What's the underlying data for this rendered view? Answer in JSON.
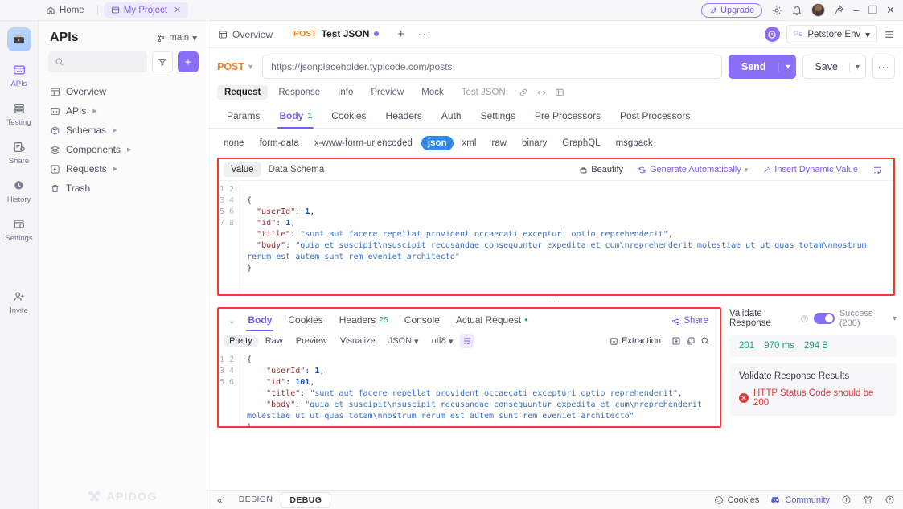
{
  "titlebar": {
    "home": "Home",
    "project": "My Project",
    "close_tab": "✕",
    "upgrade": "Upgrade",
    "icons": {
      "gear": "gear-icon",
      "bell": "bell-icon",
      "pin": "pin-icon"
    },
    "window": {
      "minimize": "–",
      "maximize": "❐",
      "close": "✕"
    }
  },
  "rail": {
    "items": [
      {
        "label": "APIs",
        "active": true
      },
      {
        "label": "Testing",
        "active": false
      },
      {
        "label": "Share",
        "active": false
      },
      {
        "label": "History",
        "active": false
      },
      {
        "label": "Settings",
        "active": false
      },
      {
        "label": "Invite",
        "active": false
      }
    ]
  },
  "sidebar": {
    "title": "APIs",
    "branch": "main",
    "search_placeholder": "",
    "filter_icon": "filter-icon",
    "add_label": "+",
    "tree": [
      {
        "label": "Overview",
        "expandable": false
      },
      {
        "label": "APIs",
        "expandable": true
      },
      {
        "label": "Schemas",
        "expandable": true
      },
      {
        "label": "Components",
        "expandable": true
      },
      {
        "label": "Requests",
        "expandable": true
      },
      {
        "label": "Trash",
        "expandable": false
      }
    ],
    "watermark": "APIDOG"
  },
  "doctabs": {
    "overview": "Overview",
    "active_tab": {
      "method": "POST",
      "name": "Test JSON"
    },
    "add": "+",
    "more": "···",
    "env": {
      "badge": "Pe",
      "name": "Petstore Env"
    }
  },
  "urlbar": {
    "method": "POST",
    "url": "https://jsonplaceholder.typicode.com/posts",
    "send": "Send",
    "save": "Save",
    "more": "···"
  },
  "request": {
    "top_tabs": [
      "Request",
      "Response",
      "Info",
      "Preview",
      "Mock"
    ],
    "top_active": "Request",
    "doc_name": "Test JSON",
    "tabs": [
      {
        "label": "Params",
        "badge": ""
      },
      {
        "label": "Body",
        "badge": "1"
      },
      {
        "label": "Cookies",
        "badge": ""
      },
      {
        "label": "Headers",
        "badge": ""
      },
      {
        "label": "Auth",
        "badge": ""
      },
      {
        "label": "Settings",
        "badge": ""
      },
      {
        "label": "Pre Processors",
        "badge": ""
      },
      {
        "label": "Post Processors",
        "badge": ""
      }
    ],
    "active_tab": "Body",
    "body_types": [
      "none",
      "form-data",
      "x-www-form-urlencoded",
      "json",
      "xml",
      "raw",
      "binary",
      "GraphQL",
      "msgpack"
    ],
    "selected_body_type": "json",
    "editor_tabs": [
      "Value",
      "Data Schema"
    ],
    "editor_active": "Value",
    "tools": {
      "beautify": "Beautify",
      "generate": "Generate Automatically",
      "insert_dynamic": "Insert Dynamic Value",
      "wrap_icon": "wrap-lines-icon"
    },
    "body_json": {
      "line_count": 8,
      "lines": [
        "",
        "{",
        "  \"userId\": 1,",
        "  \"id\": 1,",
        "  \"title\": \"sunt aut facere repellat provident occaecati excepturi optio reprehenderit\",",
        "  \"body\": \"quia et suscipit\\nsuscipit recusandae consequuntur expedita et cum\\nreprehenderit molestiae ut ut quas totam\\nnostrum rerum est autem sunt rem eveniet architecto\"",
        "}",
        ""
      ]
    }
  },
  "response": {
    "tabs": [
      {
        "label": "Body",
        "badge": ""
      },
      {
        "label": "Cookies",
        "badge": ""
      },
      {
        "label": "Headers",
        "badge": "25"
      },
      {
        "label": "Console",
        "badge": ""
      },
      {
        "label": "Actual Request",
        "badge": "dot"
      }
    ],
    "active_tab": "Body",
    "share": "Share",
    "view_modes": [
      "Pretty",
      "Raw",
      "Preview",
      "Visualize"
    ],
    "active_view": "Pretty",
    "format": "JSON",
    "encoding": "utf8",
    "extraction": "Extraction",
    "icons": [
      "save-icon",
      "copy-icon",
      "search-icon"
    ],
    "body_json": {
      "line_count": 6,
      "lines": [
        "{",
        "    \"userId\": 1,",
        "    \"id\": 101,",
        "    \"title\": \"sunt aut facere repellat provident occaecati excepturi optio reprehenderit\",",
        "    \"body\": \"quia et suscipit\\nsuscipit recusandae consequuntur expedita et cum\\nreprehenderit molestiae ut ut quas totam\\nnostrum rerum est autem sunt rem eveniet architecto\"",
        "}"
      ]
    }
  },
  "validate": {
    "title": "Validate Response",
    "help_icon": "help-icon",
    "toggle_on": true,
    "status_option": "Success (200)",
    "stats": {
      "code": "201",
      "time": "970 ms",
      "size": "294 B"
    },
    "results_title": "Validate Response Results",
    "error": "HTTP Status Code should be 200"
  },
  "statusbar": {
    "collapse": "«",
    "modes": [
      "DESIGN",
      "DEBUG"
    ],
    "active_mode": "DEBUG",
    "cookies": "Cookies",
    "community": "Community"
  },
  "colors": {
    "accent": "#8b6ef6",
    "method": "#f5821f",
    "success": "#19a974",
    "error": "#e0393a",
    "highlight": "#f5392f",
    "json_pill": "#2f86eb"
  }
}
